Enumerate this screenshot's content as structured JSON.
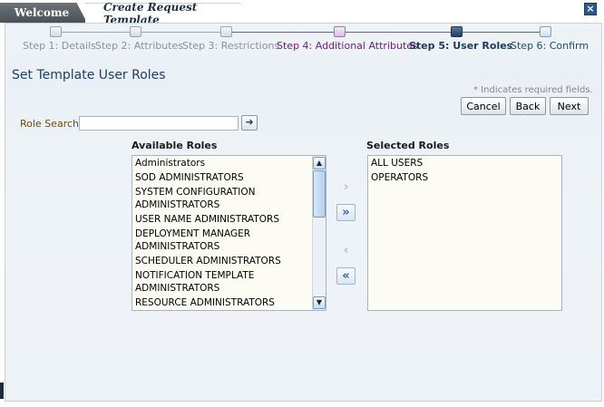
{
  "tabs": {
    "welcome_label": "Welcome",
    "active_label": "Create Request Template",
    "close_symbol": "×"
  },
  "train": {
    "steps": [
      {
        "label": "Step 1: Details",
        "state": "done"
      },
      {
        "label": "Step 2: Attributes",
        "state": "done"
      },
      {
        "label": "Step 3: Restrictions",
        "state": "done"
      },
      {
        "label": "Step 4: Additional Attributes",
        "state": "visited"
      },
      {
        "label": "Step 5: User Roles",
        "state": "current"
      },
      {
        "label": "Step 6: Confirm",
        "state": "future"
      }
    ]
  },
  "page": {
    "title": "Set Template User Roles",
    "required_note": "* Indicates required fields."
  },
  "buttons": {
    "cancel": "Cancel",
    "back": "Back",
    "next": "Next"
  },
  "search": {
    "label": "Role Search",
    "value": "",
    "go_symbol": "➜"
  },
  "available": {
    "heading": "Available Roles",
    "items": [
      "Administrators",
      "SOD ADMINISTRATORS",
      "SYSTEM CONFIGURATION ADMINISTRATORS",
      "USER NAME ADMINISTRATORS",
      "DEPLOYMENT MANAGER ADMINISTRATORS",
      "SCHEDULER ADMINISTRATORS",
      "NOTIFICATION TEMPLATE ADMINISTRATORS",
      "RESOURCE ADMINISTRATORS"
    ]
  },
  "selected": {
    "heading": "Selected Roles",
    "items": [
      "ALL USERS",
      "OPERATORS"
    ]
  },
  "shuttle": {
    "move": "›",
    "move_all": "»",
    "remove": "‹",
    "remove_all": "«"
  },
  "colors": {
    "accent": "#1f3f61",
    "visited_step": "#6a1f73",
    "done_step": "#8a9299",
    "panel_bg": "#eef3f7"
  }
}
